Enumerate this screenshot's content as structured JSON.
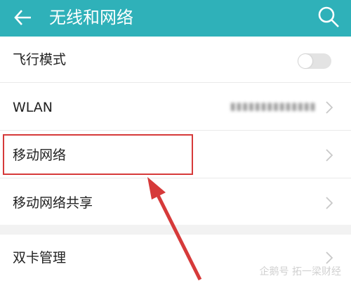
{
  "header": {
    "title": "无线和网络",
    "back_icon": "arrow-left-icon",
    "search_icon": "search-icon",
    "bg_color": "#2fb1b9"
  },
  "settings": {
    "items": [
      {
        "label": "飞行模式",
        "control": "toggle",
        "toggle_state": "off"
      },
      {
        "label": "WLAN",
        "control": "chevron",
        "value_obscured": "(blurred network name)"
      },
      {
        "label": "移动网络",
        "control": "chevron",
        "highlighted": true
      },
      {
        "label": "移动网络共享",
        "control": "chevron"
      }
    ],
    "section2": [
      {
        "label": "双卡管理",
        "control": "chevron"
      }
    ]
  },
  "annotation": {
    "highlight_color": "#d63a3a",
    "arrow_target": "移动网络"
  },
  "watermark": "企鹅号 拓一梁财经"
}
